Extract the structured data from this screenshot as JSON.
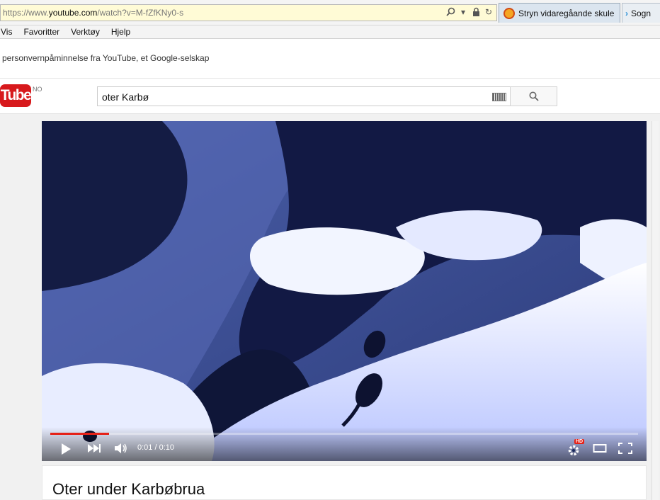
{
  "address_bar": {
    "url_prefix": "https://www.",
    "url_domain": "youtube.com",
    "url_path": "/watch?v=M-fZfKNy0-s"
  },
  "tabs": [
    {
      "label": "Stryn vidaregåande skule"
    },
    {
      "label": "Sogn"
    }
  ],
  "menu": [
    "Vis",
    "Favoritter",
    "Verktøy",
    "Hjelp"
  ],
  "notice": {
    "text": "personvernpåminnelse fra YouTube, et Google-selskap"
  },
  "masthead": {
    "logo_text": "Tube",
    "region": "NO",
    "search_value": "oter Karbø"
  },
  "player": {
    "time": "0:01 / 0:10",
    "progress_fraction": 0.1,
    "hd_badge": "HD"
  },
  "video": {
    "title": "Oter under Karbøbrua"
  },
  "colors": {
    "accent_red": "#e52117",
    "logo_red": "#d7191c"
  }
}
